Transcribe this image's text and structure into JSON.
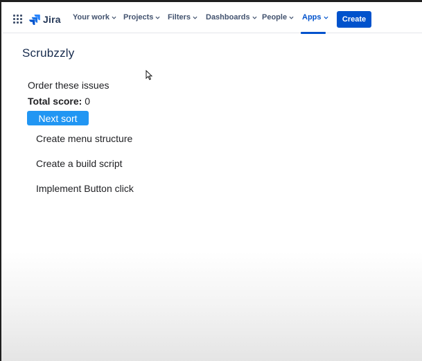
{
  "nav": {
    "logo_text": "Jira",
    "items": [
      {
        "label": "Your work"
      },
      {
        "label": "Projects"
      },
      {
        "label": "Filters"
      },
      {
        "label": "Dashboards"
      },
      {
        "label": "People"
      },
      {
        "label": "Apps"
      }
    ],
    "active_item": "Apps",
    "create_label": "Create"
  },
  "app": {
    "title": "Scrubzzly",
    "instructions": "Order these issues",
    "score_label": "Total score:",
    "score_value": "0",
    "next_sort_label": "Next sort",
    "issues": [
      {
        "title": "Create menu structure"
      },
      {
        "title": "Create a build script"
      },
      {
        "title": "Implement Button click"
      }
    ]
  },
  "colors": {
    "brand": "#0052cc",
    "next_sort_button": "#2196f3",
    "nav_text": "#42526e"
  }
}
